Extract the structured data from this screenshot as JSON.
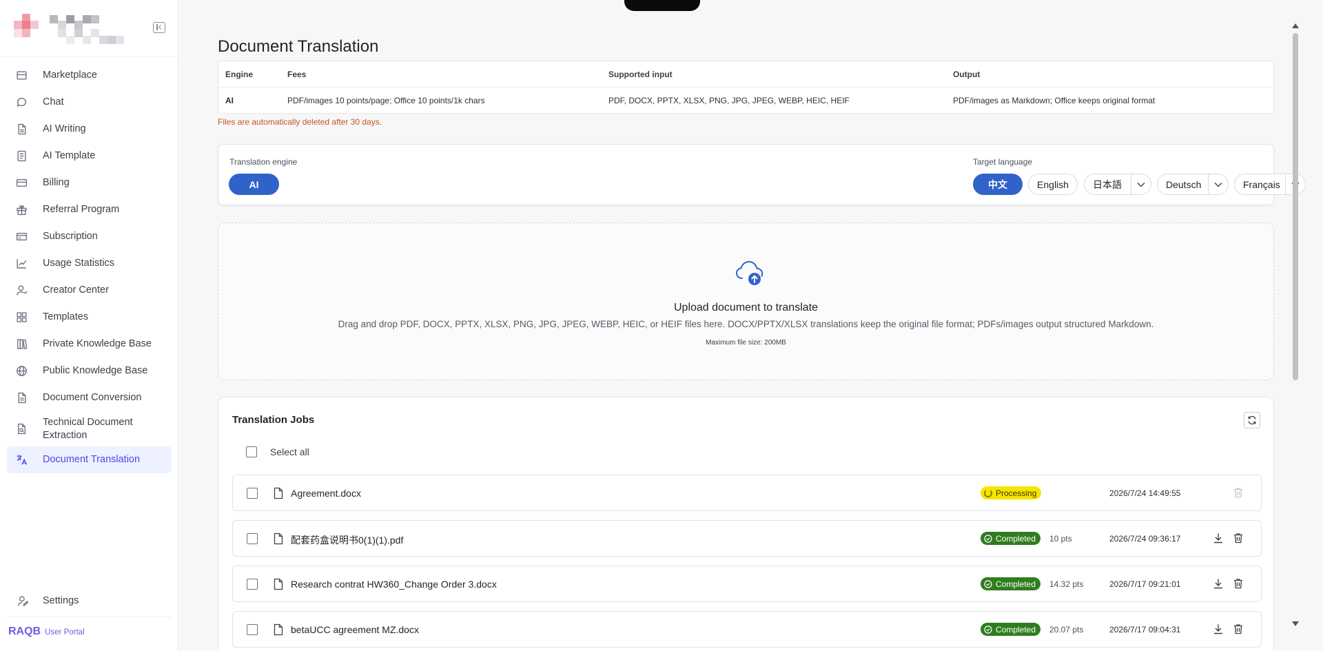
{
  "sidebar": {
    "items": [
      {
        "label": "Marketplace",
        "icon": "store-icon"
      },
      {
        "label": "Chat",
        "icon": "chat-bubble-icon"
      },
      {
        "label": "AI Writing",
        "icon": "document-icon"
      },
      {
        "label": "AI Template",
        "icon": "template-list-icon"
      },
      {
        "label": "Billing",
        "icon": "credit-card-icon"
      },
      {
        "label": "Referral Program",
        "icon": "gift-icon"
      },
      {
        "label": "Subscription",
        "icon": "card-icon"
      },
      {
        "label": "Usage Statistics",
        "icon": "line-chart-icon"
      },
      {
        "label": "Creator Center",
        "icon": "user-icon"
      },
      {
        "label": "Templates",
        "icon": "grid-icon"
      },
      {
        "label": "Private Knowledge Base",
        "icon": "books-icon"
      },
      {
        "label": "Public Knowledge Base",
        "icon": "globe-icon"
      },
      {
        "label": "Document Conversion",
        "icon": "file-convert-icon"
      },
      {
        "label": "Technical Document Extraction",
        "icon": "file-search-icon"
      },
      {
        "label": "Document Translation",
        "icon": "translate-icon"
      }
    ],
    "active_index": 14,
    "settings_label": "Settings",
    "brand_name": "RAQB",
    "brand_sub": "User Portal"
  },
  "page": {
    "title": "Document Translation",
    "info_table": {
      "headers": [
        "Engine",
        "Fees",
        "Supported input",
        "Output"
      ],
      "row": [
        "AI",
        "PDF/images 10 points/page; Office 10 points/1k chars",
        "PDF, DOCX, PPTX, XLSX, PNG, JPG, JPEG, WEBP, HEIC, HEIF",
        "PDF/images as Markdown; Office keeps original format"
      ]
    },
    "retention_note": "Files are automatically deleted after 30 days."
  },
  "engine": {
    "label": "Translation engine",
    "options": [
      "AI"
    ],
    "selected": "AI",
    "target_label": "Target language",
    "languages": [
      "中文",
      "English",
      "日本語",
      "Deutsch",
      "Français"
    ],
    "selected_language": "中文"
  },
  "upload": {
    "title": "Upload document to translate",
    "description": "Drag and drop PDF, DOCX, PPTX, XLSX, PNG, JPG, JPEG, WEBP, HEIC, or HEIF files here. DOCX/PPTX/XLSX translations keep the original file format; PDFs/images output structured Markdown.",
    "max_size": "Maximum file size: 200MB"
  },
  "jobs": {
    "title": "Translation Jobs",
    "select_all_label": "Select all",
    "rows": [
      {
        "file": "Agreement.docx",
        "status": "Processing",
        "points": "",
        "time": "2026/7/24 14:49:55"
      },
      {
        "file": "配套药盒说明书0(1)(1).pdf",
        "status": "Completed",
        "points": "10 pts",
        "time": "2026/7/24 09:36:17"
      },
      {
        "file": "Research contrat HW360_Change Order 3.docx",
        "status": "Completed",
        "points": "14.32 pts",
        "time": "2026/7/17 09:21:01"
      },
      {
        "file": "betaUCC agreement MZ.docx",
        "status": "Completed",
        "points": "20.07 pts",
        "time": "2026/7/17 09:04:31"
      }
    ]
  },
  "colors": {
    "accent": "#3063c9",
    "sidebar_active_bg": "#eef1ff",
    "sidebar_active_text": "#4f46e5",
    "processing": "#f5e500",
    "completed": "#2f7d1f",
    "warning_text": "#c0571f"
  }
}
